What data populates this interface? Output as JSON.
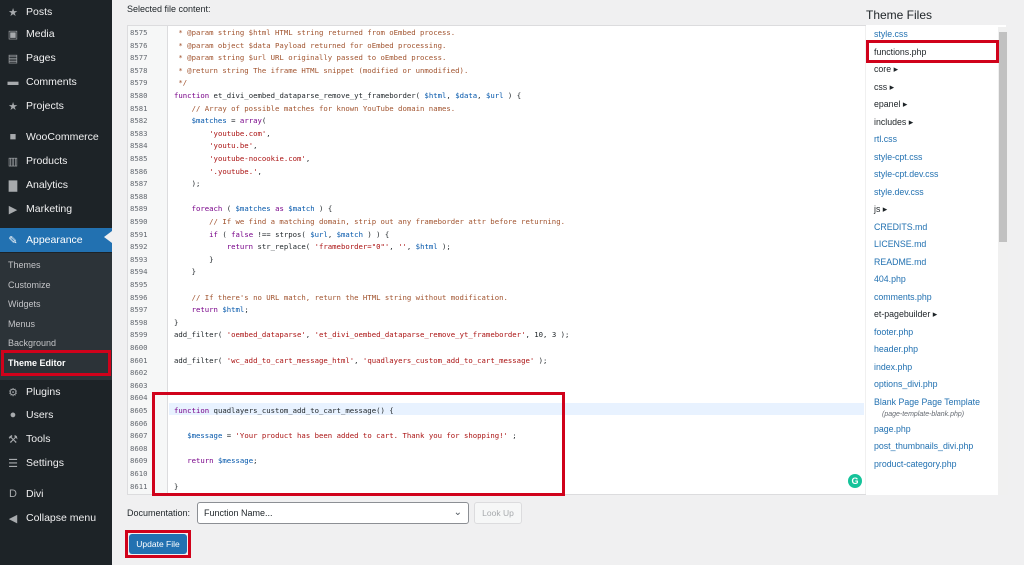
{
  "sidebar": {
    "items": [
      {
        "label": "Posts",
        "icon": "pin-icon"
      },
      {
        "label": "Media",
        "icon": "media-icon"
      },
      {
        "label": "Pages",
        "icon": "pages-icon"
      },
      {
        "label": "Comments",
        "icon": "comments-icon"
      },
      {
        "label": "Projects",
        "icon": "pin-icon"
      },
      {
        "label": "WooCommerce",
        "icon": "woocommerce-icon"
      },
      {
        "label": "Products",
        "icon": "products-icon"
      },
      {
        "label": "Analytics",
        "icon": "analytics-icon"
      },
      {
        "label": "Marketing",
        "icon": "megaphone-icon"
      },
      {
        "label": "Appearance",
        "icon": "brush-icon"
      },
      {
        "label": "Plugins",
        "icon": "plugin-icon"
      },
      {
        "label": "Users",
        "icon": "user-icon"
      },
      {
        "label": "Tools",
        "icon": "wrench-icon"
      },
      {
        "label": "Settings",
        "icon": "settings-icon"
      },
      {
        "label": "Divi",
        "icon": "divi-icon"
      },
      {
        "label": "Collapse menu",
        "icon": "collapse-icon"
      }
    ],
    "appearance_sub": [
      "Themes",
      "Customize",
      "Widgets",
      "Menus",
      "Background",
      "Theme Editor"
    ]
  },
  "editor": {
    "selected_label": "Selected file content:",
    "lines": [
      {
        "n": "8575",
        "text": " * @param string $html HTML string returned from oEmbed process."
      },
      {
        "n": "8576",
        "text": " * @param object $data Payload returned for oEmbed processing."
      },
      {
        "n": "8577",
        "text": " * @param string $url URL originally passed to oEmbed process."
      },
      {
        "n": "8578",
        "text": " * @return string The iframe HTML snippet (modified or unmodified)."
      },
      {
        "n": "8579",
        "text": " */"
      },
      {
        "n": "8580",
        "text": "function et_divi_oembed_dataparse_remove_yt_frameborder( $html, $data, $url ) {"
      },
      {
        "n": "8581",
        "text": "    // Array of possible matches for known YouTube domain names."
      },
      {
        "n": "8582",
        "text": "    $matches = array("
      },
      {
        "n": "8583",
        "text": "        'youtube.com',"
      },
      {
        "n": "8584",
        "text": "        'youtu.be',"
      },
      {
        "n": "8585",
        "text": "        'youtube-nocookie.com',"
      },
      {
        "n": "8586",
        "text": "        '.youtube.',"
      },
      {
        "n": "8587",
        "text": "    );"
      },
      {
        "n": "8588",
        "text": ""
      },
      {
        "n": "8589",
        "text": "    foreach ( $matches as $match ) {"
      },
      {
        "n": "8590",
        "text": "        // If we find a matching domain, strip out any frameborder attr before returning."
      },
      {
        "n": "8591",
        "text": "        if ( false !== strpos( $url, $match ) ) {"
      },
      {
        "n": "8592",
        "text": "            return str_replace( 'frameborder=\"0\"', '', $html );"
      },
      {
        "n": "8593",
        "text": "        }"
      },
      {
        "n": "8594",
        "text": "    }"
      },
      {
        "n": "8595",
        "text": ""
      },
      {
        "n": "8596",
        "text": "    // If there's no URL match, return the HTML string without modification."
      },
      {
        "n": "8597",
        "text": "    return $html;"
      },
      {
        "n": "8598",
        "text": "}"
      },
      {
        "n": "8599",
        "text": "add_filter( 'oembed_dataparse', 'et_divi_oembed_dataparse_remove_yt_frameborder', 10, 3 );"
      },
      {
        "n": "8600",
        "text": ""
      },
      {
        "n": "8601",
        "text": "add_filter( 'wc_add_to_cart_message_html', 'quadlayers_custom_add_to_cart_message' );"
      },
      {
        "n": "8602",
        "text": ""
      },
      {
        "n": "8603",
        "text": ""
      },
      {
        "n": "8604",
        "text": ""
      },
      {
        "n": "8605",
        "text": "function quadlayers_custom_add_to_cart_message() {"
      },
      {
        "n": "8606",
        "text": ""
      },
      {
        "n": "8607",
        "text": "   $message = 'Your product has been added to cart. Thank you for shopping!' ;"
      },
      {
        "n": "8608",
        "text": ""
      },
      {
        "n": "8609",
        "text": "   return $message;"
      },
      {
        "n": "8610",
        "text": ""
      },
      {
        "n": "8611",
        "text": "}"
      }
    ]
  },
  "documentation": {
    "label": "Documentation:",
    "placeholder": "Function Name...",
    "lookup_label": "Look Up"
  },
  "update_label": "Update File",
  "theme_files": {
    "title": "Theme Files",
    "files": [
      {
        "name": "style.css",
        "dir": false
      },
      {
        "name": "functions.php",
        "dir": false,
        "current": true
      },
      {
        "name": "core",
        "dir": true
      },
      {
        "name": "css",
        "dir": true
      },
      {
        "name": "epanel",
        "dir": true
      },
      {
        "name": "includes",
        "dir": true
      },
      {
        "name": "rtl.css",
        "dir": false
      },
      {
        "name": "style-cpt.css",
        "dir": false
      },
      {
        "name": "style-cpt.dev.css",
        "dir": false
      },
      {
        "name": "style.dev.css",
        "dir": false
      },
      {
        "name": "js",
        "dir": true
      },
      {
        "name": "CREDITS.md",
        "dir": false
      },
      {
        "name": "LICENSE.md",
        "dir": false
      },
      {
        "name": "README.md",
        "dir": false
      },
      {
        "name": "404.php",
        "dir": false
      },
      {
        "name": "comments.php",
        "dir": false
      },
      {
        "name": "et-pagebuilder",
        "dir": true
      },
      {
        "name": "footer.php",
        "dir": false
      },
      {
        "name": "header.php",
        "dir": false
      },
      {
        "name": "index.php",
        "dir": false
      },
      {
        "name": "options_divi.php",
        "dir": false
      },
      {
        "name": "Blank Page Page Template",
        "dir": false
      },
      {
        "name": "(page-template-blank.php)",
        "dir": false,
        "subtext": true
      },
      {
        "name": "page.php",
        "dir": false
      },
      {
        "name": "post_thumbnails_divi.php",
        "dir": false
      },
      {
        "name": "product-category.php",
        "dir": false
      }
    ]
  },
  "colors": {
    "sidebar_bg": "#1d2327",
    "accent": "#2271b1",
    "highlight": "#d0021b"
  }
}
